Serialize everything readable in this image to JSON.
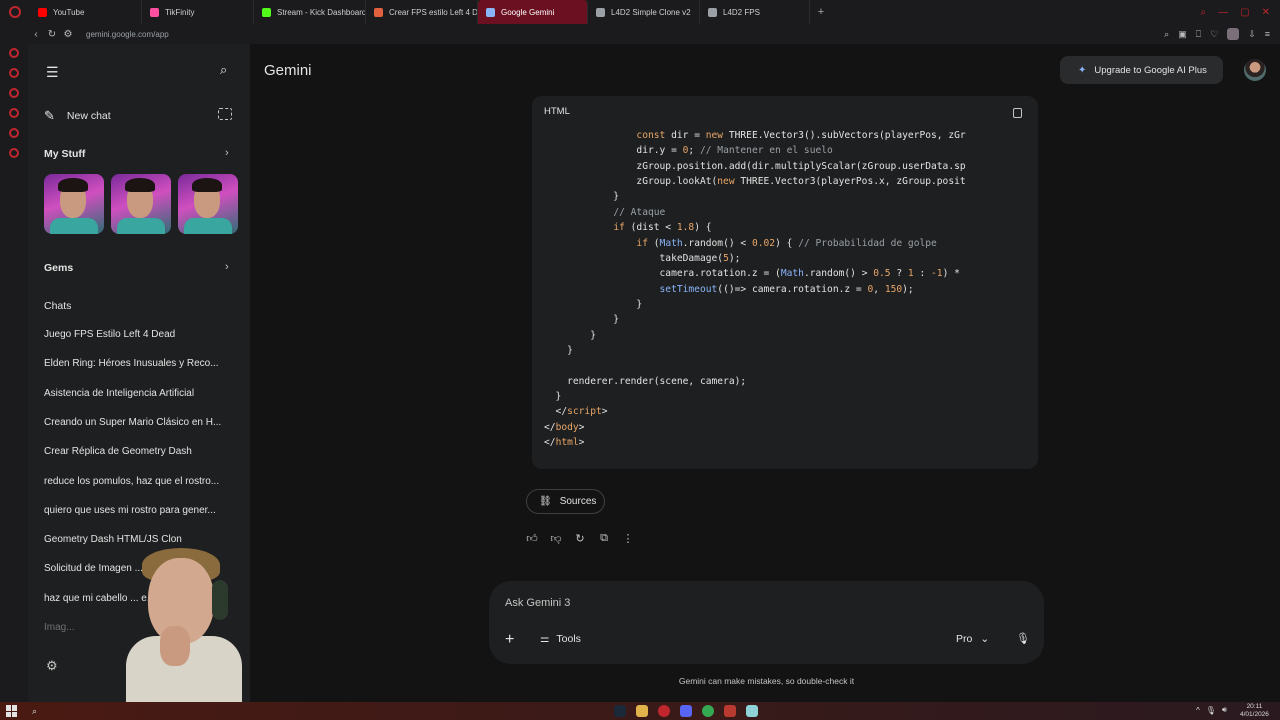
{
  "browser": {
    "tabs": [
      {
        "label": "YouTube",
        "color": "#ff0000"
      },
      {
        "label": "TikFinity",
        "color": "#ff4fa0"
      },
      {
        "label": "Stream - Kick Dashboard",
        "color": "#53fc18"
      },
      {
        "label": "Crear FPS estilo Left 4 De",
        "color": "#e06040"
      },
      {
        "label": "Google Gemini",
        "color": "#8ab4f8"
      },
      {
        "label": "L4D2 Simple Clone v2",
        "color": "#9aa0a6"
      },
      {
        "label": "L4D2 FPS",
        "color": "#9aa0a6"
      }
    ],
    "url": "gemini.google.com/app"
  },
  "sidebar": {
    "new_chat": "New chat",
    "my_stuff": "My Stuff",
    "gems": "Gems",
    "chats_title": "Chats",
    "chats": [
      "Juego FPS Estilo Left 4 Dead",
      "Elden Ring: Héroes Inusuales y Reco...",
      "Asistencia de Inteligencia Artificial",
      "Creando un Super Mario Clásico en H...",
      "Crear Réplica de Geometry Dash",
      "reduce los pomulos, haz que el rostro...",
      "quiero que uses mi rostro para gener...",
      "Geometry Dash HTML/JS Clon",
      "Solicitud de Imagen ... Amenaza...",
      "haz que mi cabello ... e...",
      "Imag..."
    ]
  },
  "header": {
    "title": "Gemini",
    "upgrade": "Upgrade to Google AI Plus"
  },
  "code": {
    "language": "HTML",
    "lines": [
      [
        {
          "t": "                ",
          "c": ""
        },
        {
          "t": "const",
          "c": "kw"
        },
        {
          "t": " dir = ",
          "c": ""
        },
        {
          "t": "new",
          "c": "kw"
        },
        {
          "t": " THREE.Vector3().subVectors(playerPos, zGr",
          "c": ""
        }
      ],
      [
        {
          "t": "                dir.y = ",
          "c": ""
        },
        {
          "t": "0",
          "c": "num"
        },
        {
          "t": "; ",
          "c": ""
        },
        {
          "t": "// Mantener en el suelo",
          "c": "cm"
        }
      ],
      [
        {
          "t": "                zGroup.position.add(dir.multiplyScalar(zGroup.userData.sp",
          "c": ""
        }
      ],
      [
        {
          "t": "                zGroup.lookAt(",
          "c": ""
        },
        {
          "t": "new",
          "c": "kw"
        },
        {
          "t": " THREE.Vector3(playerPos.x, zGroup.posit",
          "c": ""
        }
      ],
      [
        {
          "t": "            }",
          "c": ""
        }
      ],
      [
        {
          "t": "            ",
          "c": ""
        },
        {
          "t": "// Ataque",
          "c": "cm"
        }
      ],
      [
        {
          "t": "            ",
          "c": ""
        },
        {
          "t": "if",
          "c": "kw"
        },
        {
          "t": " (dist < ",
          "c": ""
        },
        {
          "t": "1.8",
          "c": "num"
        },
        {
          "t": ") {",
          "c": ""
        }
      ],
      [
        {
          "t": "                ",
          "c": ""
        },
        {
          "t": "if",
          "c": "kw"
        },
        {
          "t": " (",
          "c": ""
        },
        {
          "t": "Math",
          "c": "fn"
        },
        {
          "t": ".random() < ",
          "c": ""
        },
        {
          "t": "0.02",
          "c": "num"
        },
        {
          "t": ") { ",
          "c": ""
        },
        {
          "t": "// Probabilidad de golpe",
          "c": "cm"
        }
      ],
      [
        {
          "t": "                    takeDamage(",
          "c": ""
        },
        {
          "t": "5",
          "c": "num"
        },
        {
          "t": ");",
          "c": ""
        }
      ],
      [
        {
          "t": "                    camera.rotation.z = (",
          "c": ""
        },
        {
          "t": "Math",
          "c": "fn"
        },
        {
          "t": ".random() > ",
          "c": ""
        },
        {
          "t": "0.5",
          "c": "num"
        },
        {
          "t": " ? ",
          "c": ""
        },
        {
          "t": "1",
          "c": "num"
        },
        {
          "t": " : ",
          "c": ""
        },
        {
          "t": "-1",
          "c": "num"
        },
        {
          "t": ") *",
          "c": ""
        }
      ],
      [
        {
          "t": "                    ",
          "c": ""
        },
        {
          "t": "setTimeout",
          "c": "fn"
        },
        {
          "t": "(()=> camera.rotation.z = ",
          "c": ""
        },
        {
          "t": "0",
          "c": "num"
        },
        {
          "t": ", ",
          "c": ""
        },
        {
          "t": "150",
          "c": "num"
        },
        {
          "t": ");",
          "c": ""
        }
      ],
      [
        {
          "t": "                }",
          "c": ""
        }
      ],
      [
        {
          "t": "            }",
          "c": ""
        }
      ],
      [
        {
          "t": "        }",
          "c": ""
        }
      ],
      [
        {
          "t": "    }",
          "c": ""
        }
      ],
      [
        {
          "t": "",
          "c": ""
        }
      ],
      [
        {
          "t": "    renderer.render(scene, camera);",
          "c": ""
        }
      ],
      [
        {
          "t": "  }",
          "c": ""
        }
      ],
      [
        {
          "t": "  </",
          "c": ""
        },
        {
          "t": "script",
          "c": "tg"
        },
        {
          "t": ">",
          "c": ""
        }
      ],
      [
        {
          "t": "</",
          "c": ""
        },
        {
          "t": "body",
          "c": "tg"
        },
        {
          "t": ">",
          "c": ""
        }
      ],
      [
        {
          "t": "</",
          "c": ""
        },
        {
          "t": "html",
          "c": "tg"
        },
        {
          "t": ">",
          "c": ""
        }
      ]
    ]
  },
  "response": {
    "sources": "Sources"
  },
  "input": {
    "placeholder": "Ask Gemini 3",
    "tools": "Tools",
    "model": "Pro"
  },
  "disclaimer": "Gemini can make mistakes, so double-check it",
  "taskbar": {
    "time": "20:11",
    "date": "4/01/2026"
  }
}
